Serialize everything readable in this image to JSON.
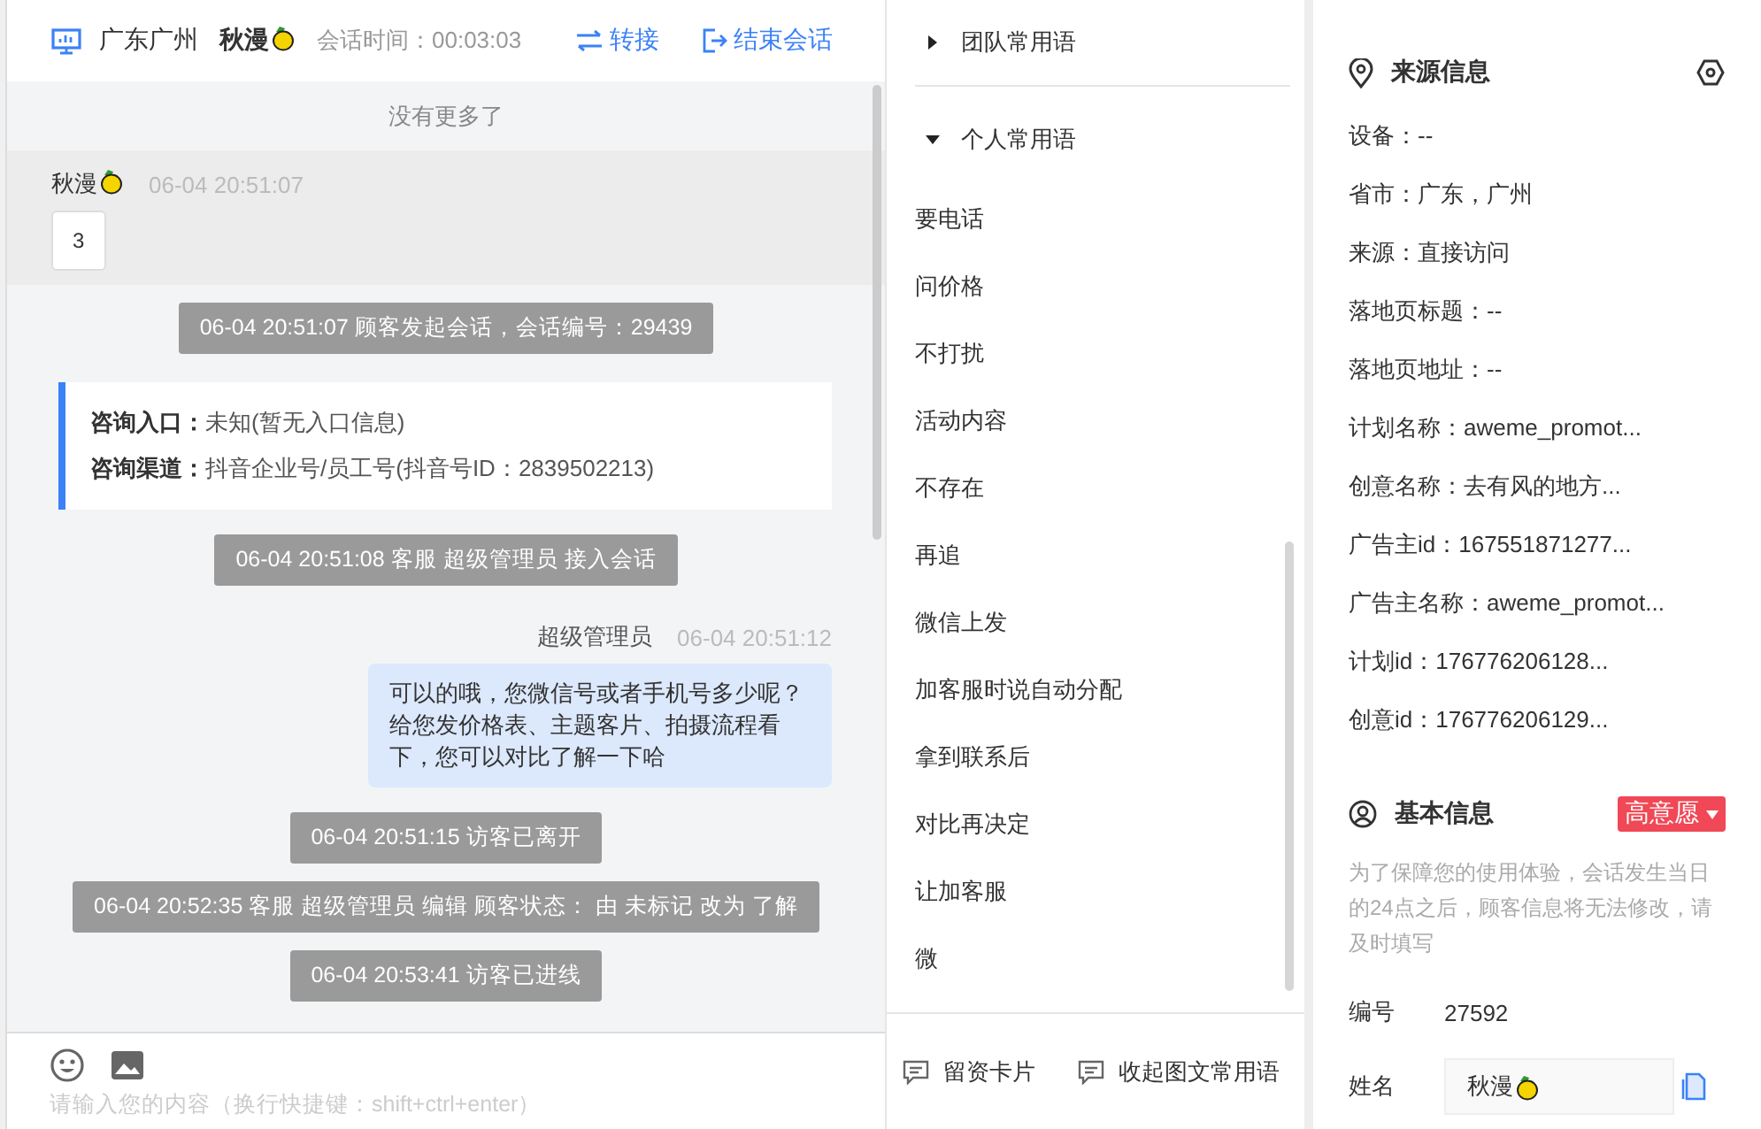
{
  "chat": {
    "header": {
      "location": "广东广州",
      "visitor": "秋漫",
      "duration_label": "会话时间：",
      "duration": "00:03:03",
      "actions": [
        {
          "label": "转接",
          "kind": "transfer"
        },
        {
          "label": "结束会话",
          "kind": "end"
        }
      ]
    },
    "no_more": "没有更多了",
    "messages": [
      {
        "kind": "visitor",
        "sender": "秋漫",
        "time": "06-04 20:51:07",
        "text": "3"
      },
      {
        "kind": "event",
        "text": "06-04 20:51:07 顾客发起会话，会话编号：29439"
      },
      {
        "kind": "info",
        "rows": [
          {
            "label": "咨询入口：",
            "value": "未知(暂无入口信息)"
          },
          {
            "label": "咨询渠道：",
            "value": "抖音企业号/员工号(抖音号ID：2839502213)"
          }
        ]
      },
      {
        "kind": "event",
        "text": "06-04 20:51:08 客服 超级管理员 接入会话"
      },
      {
        "kind": "agent",
        "sender": "超级管理员",
        "time": "06-04 20:51:12",
        "text": "可以的哦，您微信号或者手机号多少呢？给您发价格表、主题客片、拍摄流程看下，您可以对比了解一下哈"
      },
      {
        "kind": "event",
        "text": "06-04 20:51:15 访客已离开"
      },
      {
        "kind": "event",
        "text": "06-04 20:52:35 客服 超级管理员 编辑 顾客状态： 由 未标记 改为 了解"
      },
      {
        "kind": "event",
        "text": "06-04 20:53:41 访客已进线"
      }
    ],
    "composer": {
      "placeholder": "请输入您的内容（换行快捷键：shift+ctrl+enter）"
    }
  },
  "phrases": {
    "groups": [
      {
        "title": "团队常用语",
        "expanded": false
      },
      {
        "title": "个人常用语",
        "expanded": true,
        "items": [
          "要电话",
          "问价格",
          "不打扰",
          "活动内容",
          "不存在",
          "再追",
          "微信上发",
          "加客服时说自动分配",
          "拿到联系后",
          "对比再决定",
          "让加客服",
          "微"
        ]
      }
    ],
    "footer": [
      {
        "label": "留资卡片"
      },
      {
        "label": "收起图文常用语"
      }
    ]
  },
  "info": {
    "source": {
      "title": "来源信息",
      "rows": [
        "设备：--",
        "省市：广东，广州",
        "来源：直接访问",
        "落地页标题：--",
        "落地页地址：--",
        "计划名称：aweme_promot...",
        "创意名称：去有风的地方...",
        "广告主id：167551871277...",
        "广告主名称：aweme_promot...",
        "计划id：176776206128...",
        "创意id：176776206129..."
      ]
    },
    "basic": {
      "title": "基本信息",
      "tag": "高意愿",
      "notice": "为了保障您的使用体验，会话发生当日的24点之后，顾客信息将无法修改，请及时填写",
      "fields": [
        {
          "label": "编号",
          "value": "27592",
          "kind": "text"
        },
        {
          "label": "姓名",
          "value": "秋漫",
          "kind": "input"
        }
      ]
    }
  }
}
